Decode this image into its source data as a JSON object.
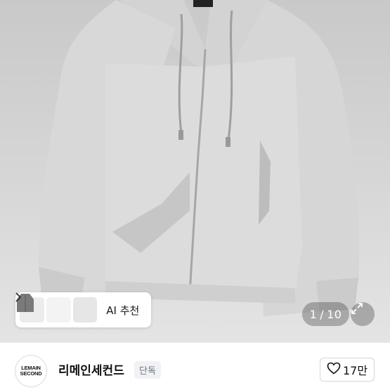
{
  "product_image": {
    "alt": "hoodie-photo",
    "counter": {
      "current": "1",
      "separator": "/",
      "total": "10"
    }
  },
  "ai_recommend": {
    "label": "AI 추천",
    "thumbnails": [
      "hoodie-gray-thumbnail",
      "hoodie-white-thumbnail",
      "hoodie-charcoal-thumbnail"
    ]
  },
  "seller": {
    "logo_line1": "LEMAIN",
    "logo_line2": "SECOND",
    "name": "리메인세컨드",
    "badge": "단독",
    "likes": "17만"
  },
  "colors": {
    "hoodie": "#d9d9d9",
    "hoodie_shadow": "#bdbdbd",
    "overlay": "rgba(60,60,60,0.35)"
  }
}
